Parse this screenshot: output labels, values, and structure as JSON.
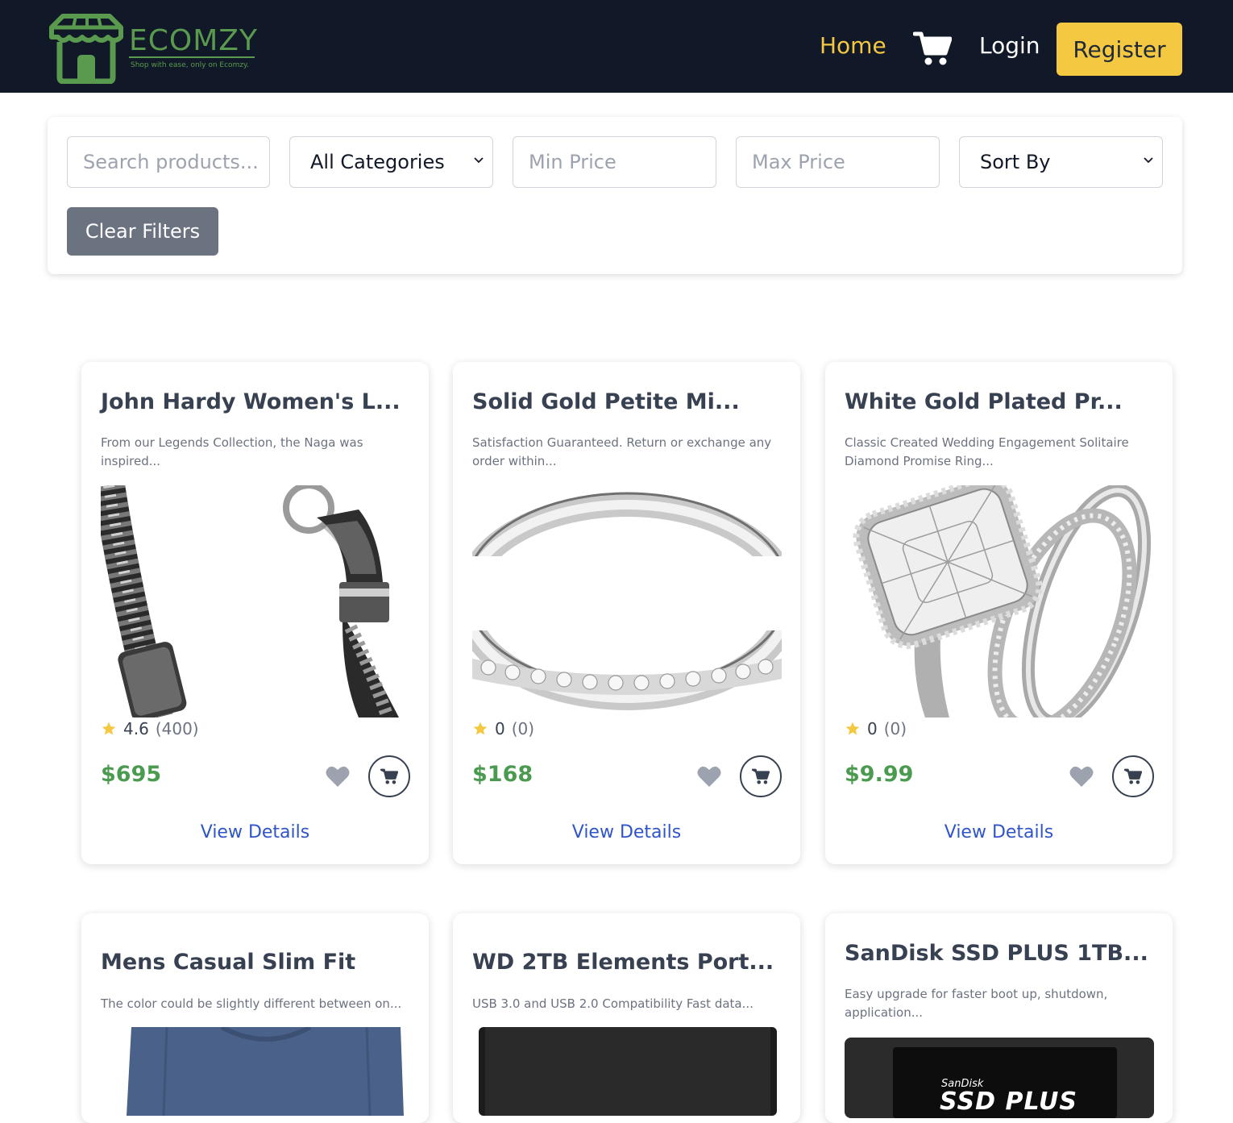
{
  "brand": {
    "name": "ECOMZY",
    "tagline": "Shop with ease, only on Ecomzy.",
    "color": "#5a9a4f"
  },
  "nav": {
    "home": "Home",
    "cart_icon": "shopping-cart-icon",
    "login": "Login",
    "register": "Register"
  },
  "filters": {
    "search_placeholder": "Search products...",
    "category_selected": "All Categories",
    "min_price_placeholder": "Min Price",
    "max_price_placeholder": "Max Price",
    "sort_selected": "Sort By",
    "clear_label": "Clear Filters"
  },
  "products": [
    {
      "title": "John Hardy Women's L...",
      "desc": "From our Legends Collection, the Naga was inspired...",
      "rating": "4.6",
      "rating_count": "(400)",
      "price": "$695",
      "link": "View Details"
    },
    {
      "title": "Solid Gold Petite Mi...",
      "desc": "Satisfaction Guaranteed. Return or exchange any order within...",
      "rating": "0",
      "rating_count": "(0)",
      "price": "$168",
      "link": "View Details"
    },
    {
      "title": "White Gold Plated Pr...",
      "desc": "Classic Created Wedding Engagement Solitaire Diamond Promise Ring...",
      "rating": "0",
      "rating_count": "(0)",
      "price": "$9.99",
      "link": "View Details"
    },
    {
      "title": "Mens Casual Slim Fit",
      "desc": "The color could be slightly different between on..."
    },
    {
      "title": "WD 2TB Elements Port...",
      "desc": "USB 3.0 and USB 2.0 Compatibility Fast data..."
    },
    {
      "title": "SanDisk SSD PLUS 1TB...",
      "desc": "Easy upgrade for faster boot up, shutdown, application...",
      "img_brand": "SanDisk",
      "img_label": "SSD PLUS"
    }
  ],
  "colors": {
    "nav_bg": "#111827",
    "accent_yellow": "#f5c842",
    "price_green": "#4a9a4f",
    "link_blue": "#2f55c9",
    "clear_btn": "#6b7280"
  }
}
